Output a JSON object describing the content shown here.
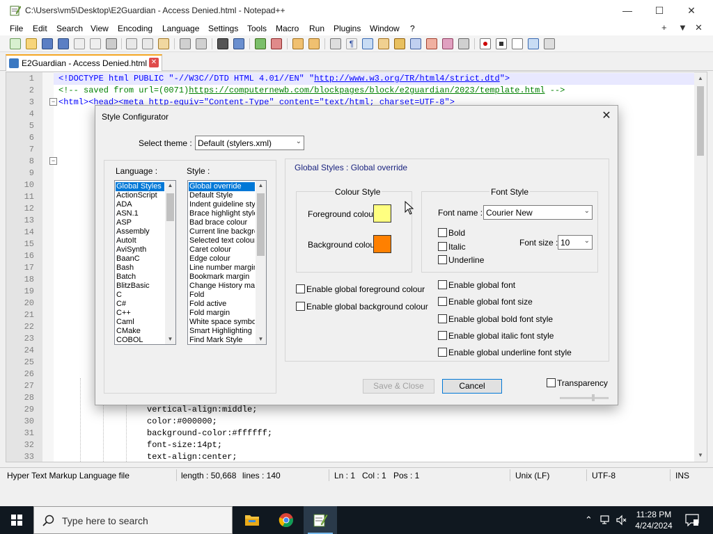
{
  "window": {
    "title": "C:\\Users\\vm5\\Desktop\\E2Guardian - Access Denied.html - Notepad++",
    "minimize": "—",
    "maximize": "☐",
    "close": "✕"
  },
  "menu": {
    "items": [
      "File",
      "Edit",
      "Search",
      "View",
      "Encoding",
      "Language",
      "Settings",
      "Tools",
      "Macro",
      "Run",
      "Plugins",
      "Window",
      "?"
    ],
    "right": [
      "+",
      "▼",
      "✕"
    ]
  },
  "tab": {
    "label": "E2Guardian - Access Denied.html",
    "close": "✕"
  },
  "editor": {
    "line_numbers": [
      "1",
      "2",
      "3",
      "4",
      "5",
      "6",
      "7",
      "8",
      "9",
      "10",
      "11",
      "12",
      "13",
      "14",
      "15",
      "16",
      "17",
      "18",
      "19",
      "20",
      "21",
      "22",
      "23",
      "24",
      "25",
      "26",
      "27",
      "28",
      "29",
      "30",
      "31",
      "32",
      "33"
    ],
    "lines": {
      "l1": {
        "a": "<!DOCTYPE html PUBLIC \"-//W3C//DTD HTML 4.01//EN\" \"",
        "b": "http://www.w3.org/TR/html4/strict.dtd",
        "c": "\">"
      },
      "l2": {
        "a": "<!-- saved from url=(0071)",
        "b": "https://computernewb.com/blockpages/block/e2guardian/2023/template.html",
        "c": " -->"
      },
      "l3": {
        "a": "<html><head><meta http-equiv=\"Content-Type\" content=\"text/html; charset=UTF-8\">"
      },
      "l29": "vertical-align:middle;",
      "l30": "color:#000000;",
      "l31": "background-color:#ffffff;",
      "l32": "font-size:14pt;",
      "l33": "text-align:center;"
    }
  },
  "status": {
    "file_type": "Hyper Text Markup Language file",
    "length": "length : 50,668",
    "lines": "lines : 140",
    "ln": "Ln : 1",
    "col": "Col : 1",
    "pos": "Pos : 1",
    "eol": "Unix (LF)",
    "encoding": "UTF-8",
    "mode": "INS"
  },
  "dialog": {
    "title": "Style Configurator",
    "close": "✕",
    "select_theme_label": "Select theme :",
    "theme_value": "Default (stylers.xml)",
    "language_label": "Language :",
    "style_label": "Style :",
    "languages": [
      "Global Styles",
      "ActionScript",
      "ADA",
      "ASN.1",
      "ASP",
      "Assembly",
      "AutoIt",
      "AviSynth",
      "BaanC",
      "Bash",
      "Batch",
      "BlitzBasic",
      "C",
      "C#",
      "C++",
      "Caml",
      "CMake",
      "COBOL"
    ],
    "styles": [
      "Global override",
      "Default Style",
      "Indent guideline style",
      "Brace highlight style",
      "Bad brace colour",
      "Current line background colour",
      "Selected text colour",
      "Caret colour",
      "Edge colour",
      "Line number margin",
      "Bookmark margin",
      "Change History margin",
      "Fold",
      "Fold active",
      "Fold margin",
      "White space symbol",
      "Smart Highlighting",
      "Find Mark Style"
    ],
    "section_title": "Global Styles : Global override",
    "colour_style_title": "Colour Style",
    "foreground_label": "Foreground colour",
    "background_label": "Background colour",
    "foreground_color": "#ffff80",
    "background_color": "#ff8000",
    "font_style_title": "Font Style",
    "font_name_label": "Font name :",
    "font_name_value": "Courier New",
    "bold_label": "Bold",
    "italic_label": "Italic",
    "underline_label": "Underline",
    "font_size_label": "Font size :",
    "font_size_value": "10",
    "enable_fg": "Enable global foreground colour",
    "enable_bg": "Enable global background colour",
    "enable_font": "Enable global font",
    "enable_font_size": "Enable global font size",
    "enable_bold": "Enable global bold font style",
    "enable_italic": "Enable global italic font style",
    "enable_underline": "Enable global underline font style",
    "save_close": "Save & Close",
    "cancel": "Cancel",
    "transparency": "Transparency"
  },
  "taskbar": {
    "search_placeholder": "Type here to search",
    "time": "11:28 PM",
    "date": "4/24/2024"
  },
  "colors": {
    "selection": "#0078d7",
    "section_title": "#1a237e",
    "taskbar": "#101820"
  }
}
